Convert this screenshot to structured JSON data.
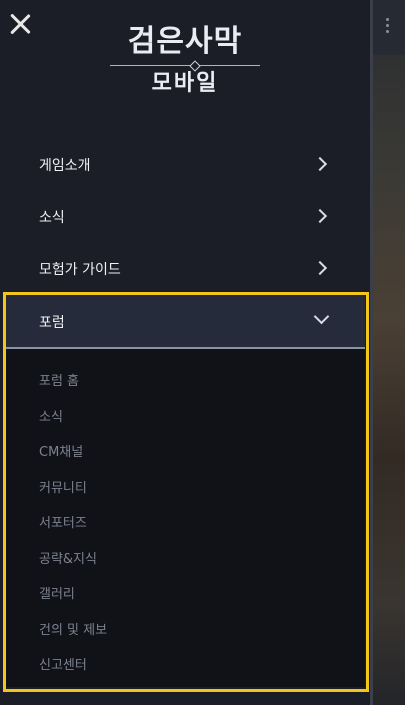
{
  "close_label": "close",
  "logo": {
    "title": "검은사막",
    "subtitle": "모바일"
  },
  "nav": [
    {
      "label": "게임소개"
    },
    {
      "label": "소식"
    },
    {
      "label": "모험가 가이드"
    }
  ],
  "forum": {
    "label": "포럼",
    "expanded": true,
    "items": [
      "포럼 홈",
      "소식",
      "CM채널",
      "커뮤니티",
      "서포터즈",
      "공략&지식",
      "갤러리",
      "건의 및 제보",
      "신고센터"
    ]
  },
  "colors": {
    "highlight": "#f5c61a",
    "drawer_bg": "#1b1e27",
    "active_bg": "#252b3a"
  }
}
